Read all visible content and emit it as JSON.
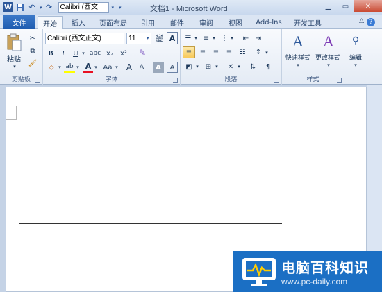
{
  "titlebar": {
    "app_icon": "W",
    "qat_font": "Calibri (西文",
    "title": "文档1 - Microsoft Word",
    "window_buttons": [
      "minimize",
      "maximize",
      "close"
    ]
  },
  "tabs": {
    "file": "文件",
    "items": [
      "开始",
      "插入",
      "页面布局",
      "引用",
      "邮件",
      "审阅",
      "视图",
      "Add-Ins",
      "开发工具"
    ],
    "active": "开始"
  },
  "clipboard": {
    "paste": "粘贴",
    "label": "剪贴板"
  },
  "font": {
    "name": "Calibri (西文正文)",
    "size": "11",
    "label": "字体",
    "buttons": {
      "bold": "B",
      "italic": "I",
      "underline": "U",
      "strike": "abc",
      "subscript": "x₂",
      "superscript": "x²",
      "grow": "A",
      "shrink": "A",
      "case": "Aa",
      "clear": "A",
      "font_color": "A",
      "char_border": "A",
      "phonetic": "變",
      "highlight": "ab"
    }
  },
  "paragraph": {
    "label": "段落"
  },
  "styles": {
    "quick": "快速样式",
    "change": "更改样式",
    "label": "样式"
  },
  "editing": {
    "label": "编辑"
  },
  "watermark": {
    "cn": "电脑百科知识",
    "url": "www.pc-daily.com"
  },
  "colors": {
    "accent": "#1b6fc4",
    "file_tab": "#2b579a",
    "font_color": "#e81123",
    "highlight": "#ffff00"
  }
}
